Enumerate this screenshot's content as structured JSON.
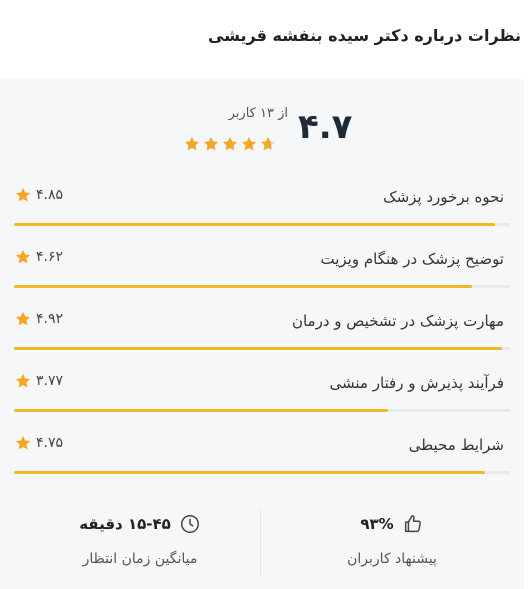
{
  "page": {
    "title": "نظرات درباره دکتر سیده بنفشه قریشی"
  },
  "summary": {
    "score": "۴.۷",
    "users_count": "از ۱۳ کاربر",
    "star_rating": 4.7,
    "star_color": "#f6a623"
  },
  "ratings": [
    {
      "label": "نحوه برخورد پزشک",
      "score": "۴.۸۵",
      "value": 4.85
    },
    {
      "label": "توضیح پزشک در هنگام ویزیت",
      "score": "۴.۶۲",
      "value": 4.62
    },
    {
      "label": "مهارت پزشک در تشخیص و درمان",
      "score": "۴.۹۲",
      "value": 4.92
    },
    {
      "label": "فرآیند پذیرش و رفتار منشی",
      "score": "۳.۷۷",
      "value": 3.77
    },
    {
      "label": "شرایط محیطی",
      "score": "۴.۷۵",
      "value": 4.75
    }
  ],
  "stats": {
    "recommend": {
      "value": "۹۳%",
      "caption": "پیشنهاد کاربران",
      "icon": "thumbs-up-icon"
    },
    "wait_time": {
      "value": "۱۵-۴۵ دقیقه",
      "caption": "میانگین زمان انتظار",
      "icon": "clock-icon"
    }
  },
  "colors": {
    "accent": "#f6b623",
    "card_background": "#f6f7f9",
    "track": "#e9e9ea"
  }
}
